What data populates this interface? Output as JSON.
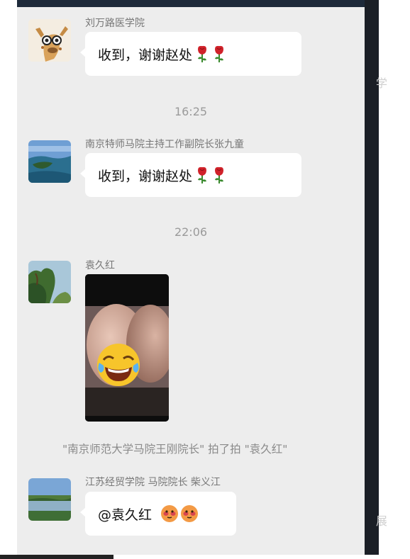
{
  "messages": [
    {
      "sender": "刘万路医学院",
      "text": "收到，谢谢赵处"
    },
    {
      "sender": "南京特师马院主持工作副院长张九童",
      "text": "收到，谢谢赵处"
    },
    {
      "sender": "袁久红"
    },
    {
      "sender": "江苏经贸学院 马院院长 柴义江",
      "text": "@袁久红"
    }
  ],
  "timestamps": [
    "16:25",
    "22:06"
  ],
  "system_message": "\"南京师范大学马院王刚院长\" 拍了拍 \"袁久红\"",
  "background_fragments": {
    "top": "学",
    "bottom": "展"
  },
  "icons": {
    "rose": "rose-emoji",
    "laugh": "tears-of-joy-emoji",
    "blush": "blushing-face-emoji"
  },
  "colors": {
    "chat_bg": "#ededed",
    "bubble": "#ffffff",
    "sender": "#777777",
    "timestamp": "#9a9a9a"
  }
}
